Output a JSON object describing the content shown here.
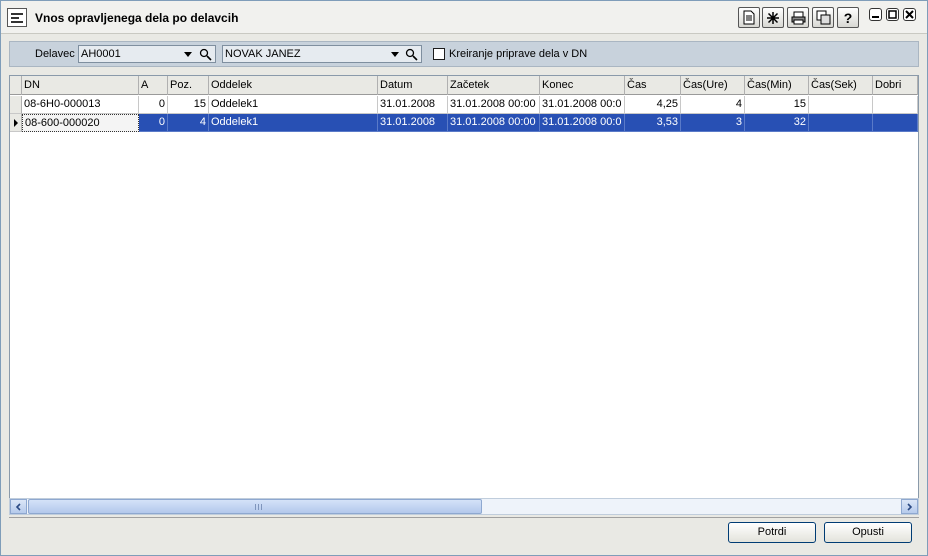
{
  "window": {
    "title": "Vnos opravljenega dela po delavcih",
    "icons": [
      "new-document-icon",
      "asterisk-icon",
      "print-icon",
      "copy-icon",
      "help-icon"
    ],
    "controls": [
      "minimize-icon",
      "maximize-icon",
      "close-icon"
    ]
  },
  "filter": {
    "delavec_label": "Delavec",
    "delavec_code": "AH0001",
    "delavec_name": "NOVAK JANEZ",
    "checkbox_label": "Kreiranje priprave dela v DN",
    "checkbox_checked": false
  },
  "grid": {
    "columns": [
      "DN",
      "A",
      "Poz.",
      "Oddelek",
      "Datum",
      "Začetek",
      "Konec",
      "Čas",
      "Čas(Ure)",
      "Čas(Min)",
      "Čas(Sek)",
      "Dobri"
    ],
    "rows": [
      [
        "08-6H0-000013",
        "0",
        "15",
        "Oddelek1",
        "31.01.2008",
        "31.01.2008 00:00",
        "31.01.2008 00:0",
        "4,25",
        "4",
        "15",
        "",
        ""
      ],
      [
        "08-600-000020",
        "0",
        "4",
        "Oddelek1",
        "31.01.2008",
        "31.01.2008 00:00",
        "31.01.2008 00:0",
        "3,53",
        "3",
        "32",
        "",
        ""
      ]
    ],
    "selected_row": 1
  },
  "scrollbar": {
    "position": 0,
    "visible_fraction": 0.52
  },
  "buttons": {
    "potrdi": "Potrdi",
    "opusti": "Opusti"
  },
  "colors": {
    "selection": "#2850b4",
    "filter_bar": "#c8d2dc",
    "window_bg": "#e9e9e4"
  }
}
